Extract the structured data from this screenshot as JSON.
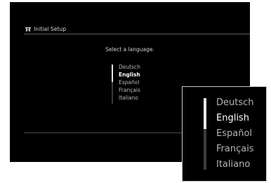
{
  "header": {
    "icon": "setup-toolbox-icon",
    "title": "Initial Setup"
  },
  "prompt": "Select a language.",
  "languages": {
    "selected_index": 1,
    "items": [
      "Deutsch",
      "English",
      "Español",
      "Français",
      "Italiano"
    ]
  },
  "zoom": {
    "items": [
      "Deutsch",
      "English",
      "Español",
      "Français",
      "Italiano"
    ]
  },
  "colors": {
    "background": "#000000",
    "text_dim": "#b8b8b8",
    "text_selected": "#ffffff",
    "rule": "#5e5e5e"
  }
}
